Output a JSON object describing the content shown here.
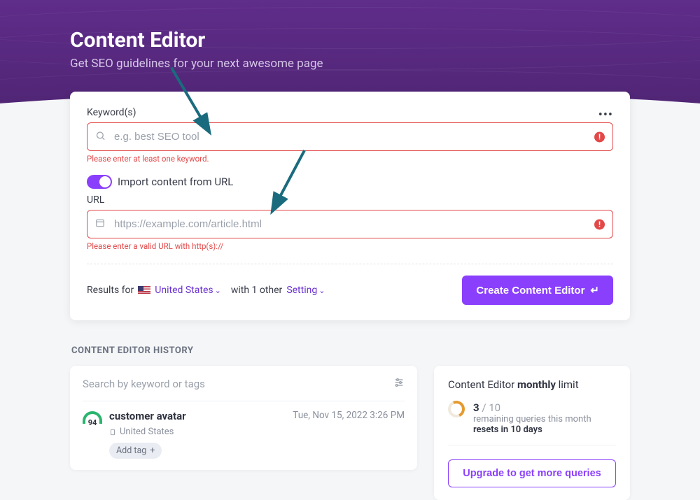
{
  "header": {
    "title": "Content Editor",
    "subtitle": "Get SEO guidelines for your next awesome page"
  },
  "form": {
    "keywords_label": "Keyword(s)",
    "keywords_placeholder": "e.g. best SEO tool",
    "keywords_error": "Please enter at least one keyword.",
    "import_toggle_label": "Import content from URL",
    "url_label": "URL",
    "url_placeholder": "https://example.com/article.html",
    "url_error": "Please enter a valid URL with http(s)://",
    "results_for": "Results for",
    "country": "United States",
    "with_settings_prefix": "with 1 other",
    "settings_link": "Setting",
    "create_button": "Create Content Editor"
  },
  "history": {
    "section_title": "CONTENT EDITOR HISTORY",
    "search_placeholder": "Search by keyword or tags",
    "items": [
      {
        "score": "94",
        "title": "customer avatar",
        "country": "United States",
        "date": "Tue, Nov 15, 2022 3:26 PM",
        "add_tag": "Add tag"
      }
    ]
  },
  "limit": {
    "title_prefix": "Content Editor ",
    "title_bold": "monthly",
    "title_suffix": " limit",
    "used": "3",
    "total": " / 10",
    "text": "remaining queries this month",
    "reset": "resets in 10 days",
    "upgrade_button": "Upgrade to get more queries"
  }
}
